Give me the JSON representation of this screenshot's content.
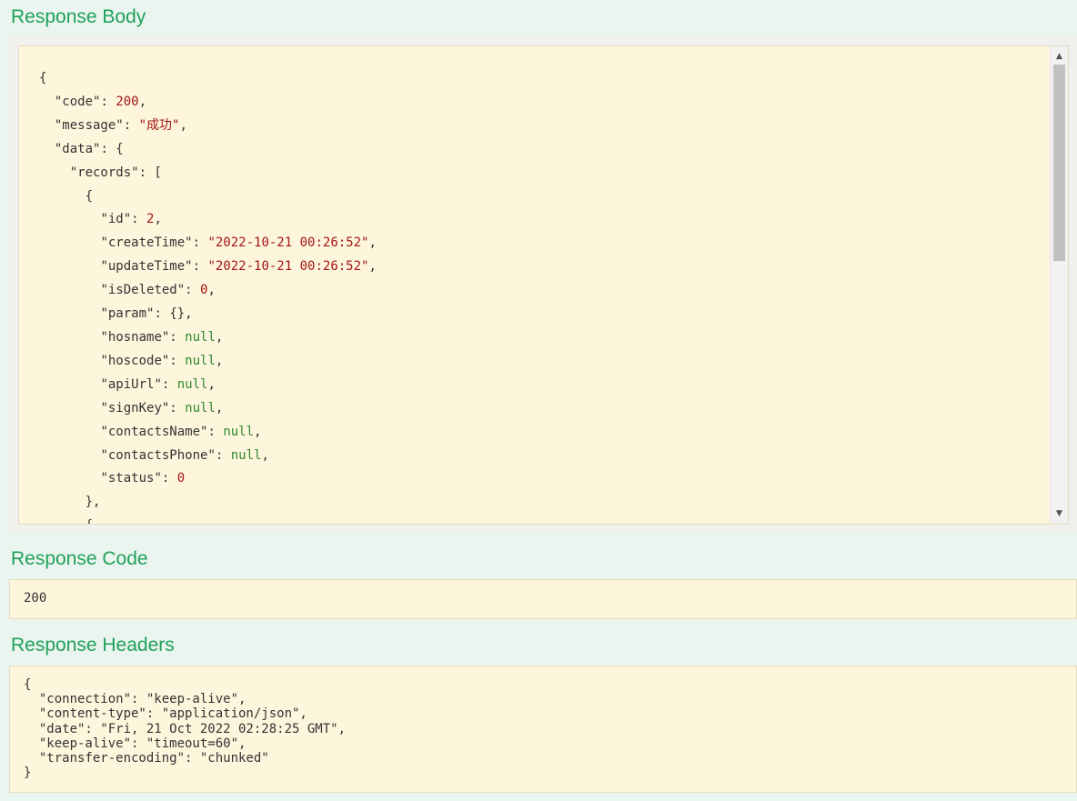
{
  "sections": {
    "body_title": "Response Body",
    "code_title": "Response Code",
    "headers_title": "Response Headers"
  },
  "response_body": {
    "code_key": "\"code\"",
    "code_val": "200",
    "message_key": "\"message\"",
    "message_val": "\"成功\"",
    "data_key": "\"data\"",
    "records_key": "\"records\"",
    "record": [
      {
        "key": "\"id\"",
        "val": "2",
        "type": "n"
      },
      {
        "key": "\"createTime\"",
        "val": "\"2022-10-21 00:26:52\"",
        "type": "s"
      },
      {
        "key": "\"updateTime\"",
        "val": "\"2022-10-21 00:26:52\"",
        "type": "s"
      },
      {
        "key": "\"isDeleted\"",
        "val": "0",
        "type": "n"
      },
      {
        "key": "\"param\"",
        "val": "{}",
        "type": "p"
      },
      {
        "key": "\"hosname\"",
        "val": "null",
        "type": "nl"
      },
      {
        "key": "\"hoscode\"",
        "val": "null",
        "type": "nl"
      },
      {
        "key": "\"apiUrl\"",
        "val": "null",
        "type": "nl"
      },
      {
        "key": "\"signKey\"",
        "val": "null",
        "type": "nl"
      },
      {
        "key": "\"contactsName\"",
        "val": "null",
        "type": "nl"
      },
      {
        "key": "\"contactsPhone\"",
        "val": "null",
        "type": "nl"
      },
      {
        "key": "\"status\"",
        "val": "0",
        "type": "n"
      }
    ]
  },
  "response_code": "200",
  "response_headers": [
    "{",
    "  \"connection\": \"keep-alive\",",
    "  \"content-type\": \"application/json\",",
    "  \"date\": \"Fri, 21 Oct 2022 02:28:25 GMT\",",
    "  \"keep-alive\": \"timeout=60\",",
    "  \"transfer-encoding\": \"chunked\"",
    "}"
  ],
  "scrollbar": {
    "up_icon": "▲",
    "down_icon": "▼"
  }
}
